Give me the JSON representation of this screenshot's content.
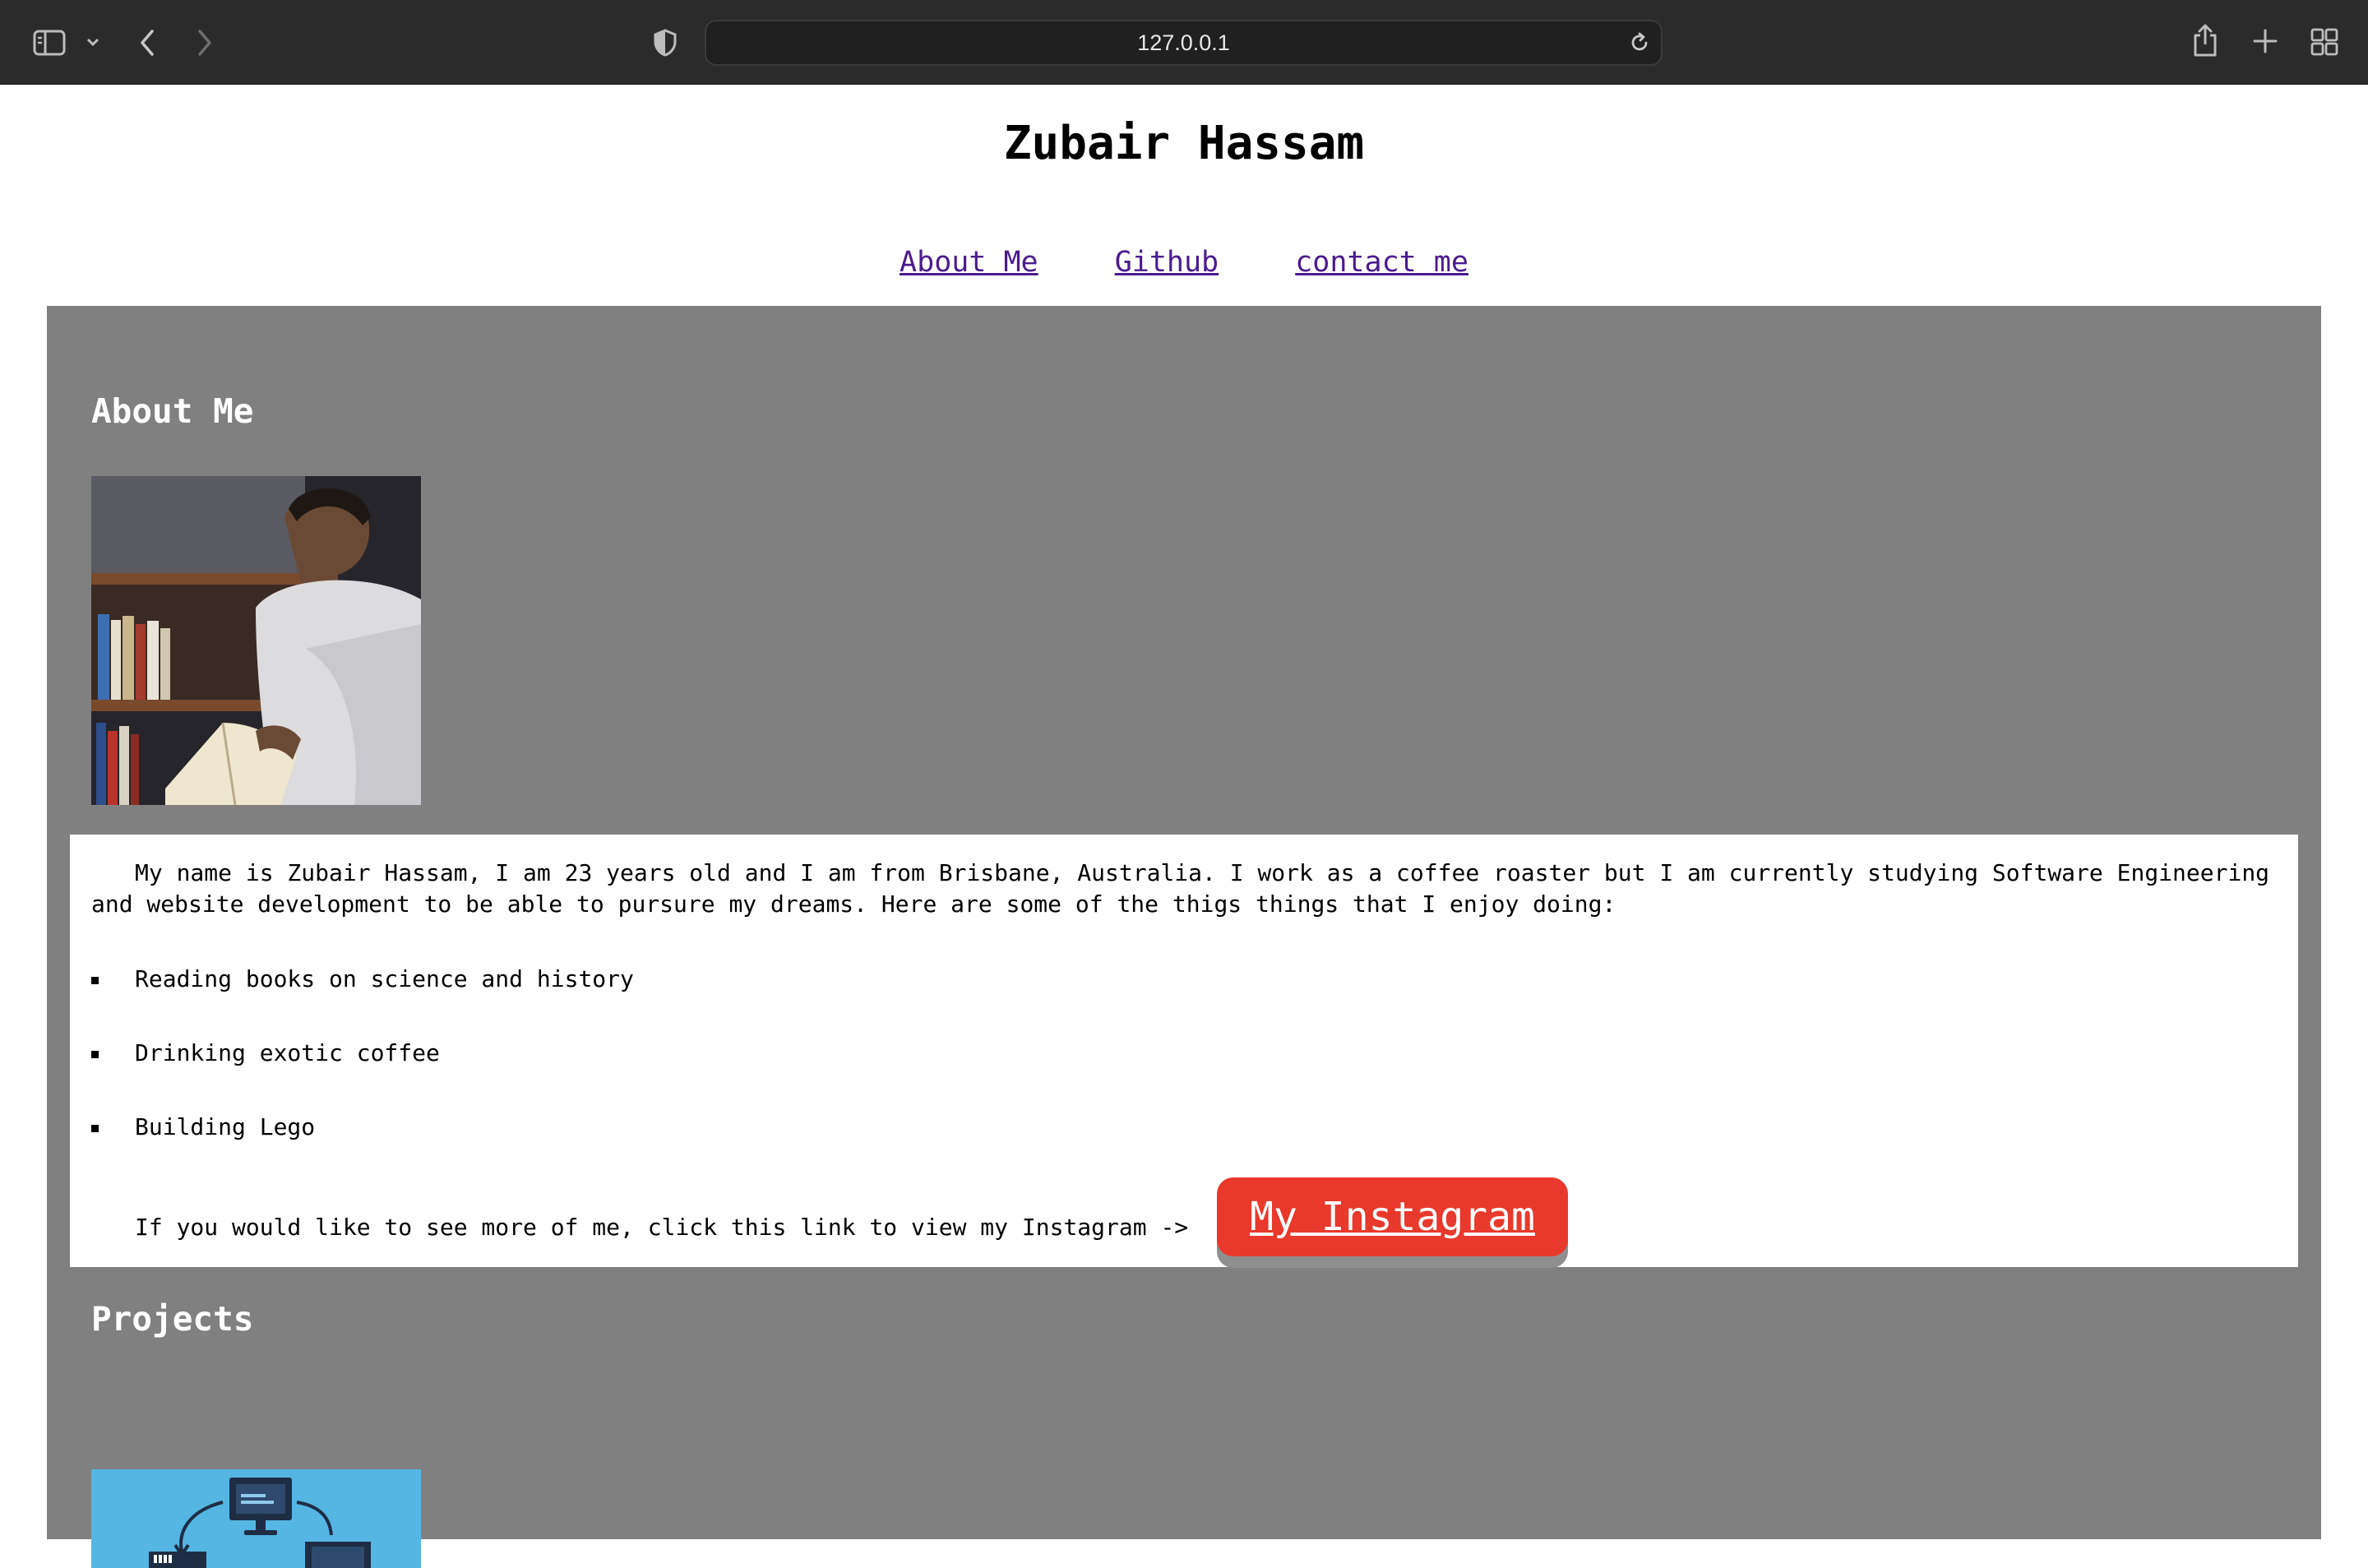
{
  "browser": {
    "url": "127.0.0.1",
    "icons": [
      "sidebar-icon",
      "chevron-down-icon",
      "back-icon",
      "forward-icon",
      "privacy-shield-icon",
      "reload-icon",
      "share-icon",
      "new-tab-icon",
      "tab-overview-icon"
    ]
  },
  "site": {
    "title": "Zubair Hassam",
    "nav": [
      "About Me",
      "Github",
      "contact me"
    ]
  },
  "about": {
    "heading": "About Me",
    "paragraph": "My name is Zubair Hassam, I am 23 years old and I am from Brisbane, Australia. I work as a coffee roaster but I am currently studying Software Engineering and website development to be able to pursure my dreams. Here are some of the thigs things that I enjoy doing:",
    "interests": [
      "Reading books on science and history",
      "Drinking exotic coffee",
      "Building Lego"
    ],
    "instagram_prompt": "If you would like to see more of me, click this link to view my Instagram ->",
    "instagram_button": "My Instagram"
  },
  "projects": {
    "heading": "Projects"
  },
  "colors": {
    "chrome_bg": "#2b2b2b",
    "section_bg": "#808080",
    "instagram_button": "#e8392c",
    "link": "#4b1b8e"
  }
}
